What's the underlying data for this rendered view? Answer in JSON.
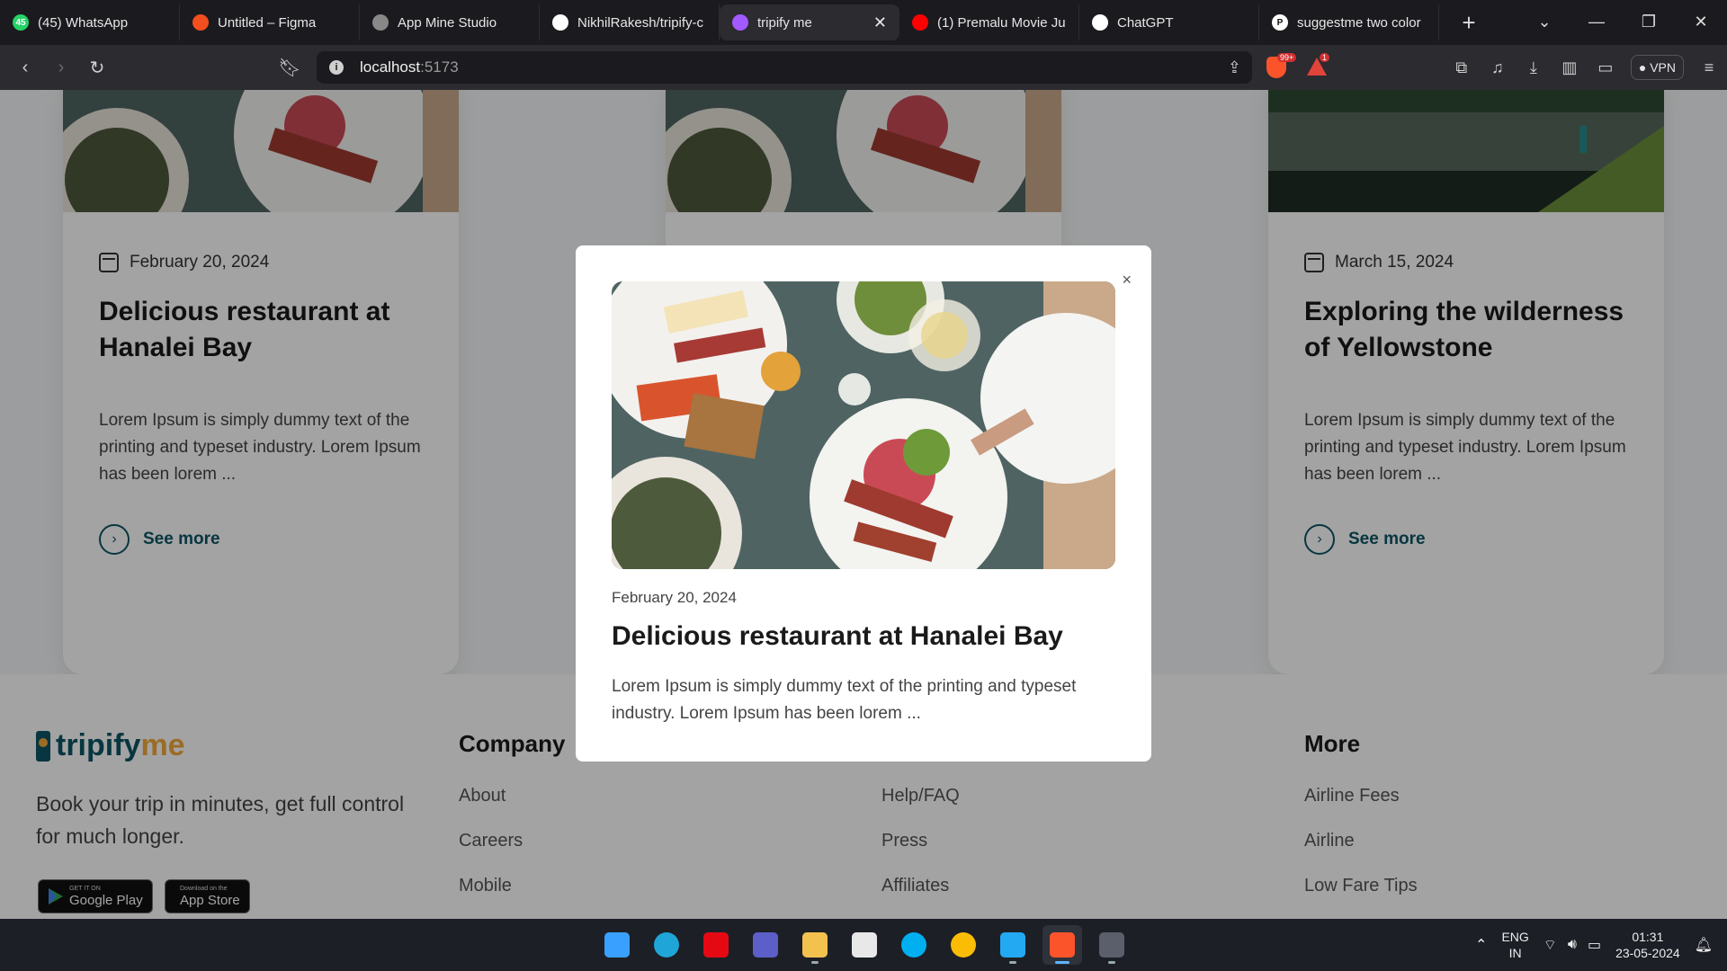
{
  "tabs": [
    {
      "title": "(45) WhatsApp",
      "icon": "whatsapp-icon",
      "color": "#25d366",
      "glyph": "45"
    },
    {
      "title": "Untitled – Figma",
      "icon": "figma-icon",
      "color": "#f24e1e",
      "glyph": ""
    },
    {
      "title": "App Mine Studio",
      "icon": "globe-icon",
      "color": "#888888",
      "glyph": ""
    },
    {
      "title": "NikhilRakesh/tripify-c",
      "icon": "github-icon",
      "color": "#ffffff",
      "glyph": ""
    },
    {
      "title": "tripify me",
      "icon": "vite-icon",
      "color": "#a259ff",
      "glyph": "",
      "active": true
    },
    {
      "title": "(1) Premalu Movie Ju",
      "icon": "youtube-icon",
      "color": "#ff0000",
      "glyph": ""
    },
    {
      "title": "ChatGPT",
      "icon": "chatgpt-icon",
      "color": "#ffffff",
      "glyph": ""
    },
    {
      "title": "suggestme two color",
      "icon": "perplexity-icon",
      "color": "#ffffff",
      "glyph": "P"
    }
  ],
  "address": {
    "host": "localhost",
    "port": ":5173"
  },
  "brave_badge": "99+",
  "alert_badge": "1",
  "vpn_label": "VPN",
  "cards": [
    {
      "date": "February 20, 2024",
      "title": "Delicious restaurant at Hanalei Bay",
      "excerpt": "Lorem Ipsum is simply dummy text of the printing and typeset industry. Lorem Ipsum has been lorem ...",
      "see_more": "See more",
      "image": "food"
    },
    {
      "date": "",
      "title": "",
      "excerpt": "",
      "see_more": "",
      "image": "food"
    },
    {
      "date": "March 15, 2024",
      "title": "Exploring the wilderness of Yellowstone",
      "excerpt": "Lorem Ipsum is simply dummy text of the printing and typeset industry. Lorem Ipsum has been lorem ...",
      "see_more": "See more",
      "image": "lake"
    }
  ],
  "footer": {
    "logo_part1": "tripify",
    "logo_part2": "me",
    "tagline": "Book your trip in minutes, get full control for much longer.",
    "google_play_small": "GET IT ON",
    "google_play": "Google Play",
    "app_store_small": "Download on the",
    "app_store": "App Store",
    "columns": [
      {
        "heading": "Company",
        "links": [
          "About",
          "Careers",
          "Mobile"
        ]
      },
      {
        "heading": "",
        "links": [
          "Help/FAQ",
          "Press",
          "Affiliates"
        ]
      },
      {
        "heading": "More",
        "links": [
          "Airline Fees",
          "Airline",
          "Low Fare Tips"
        ]
      }
    ]
  },
  "modal": {
    "close": "×",
    "date": "February 20, 2024",
    "title": "Delicious restaurant at Hanalei Bay",
    "text": "Lorem Ipsum is simply dummy text of the printing and typeset industry. Lorem Ipsum has been lorem ..."
  },
  "taskbar": {
    "apps": [
      "windows-start-icon",
      "edge-icon",
      "netflix-icon",
      "teams-icon",
      "file-explorer-icon",
      "ms-store-icon",
      "skype-icon",
      "chrome-icon",
      "vscode-icon",
      "brave-icon",
      "terminal-icon"
    ],
    "lang": "ENG",
    "region": "IN",
    "time": "01:31",
    "date": "23-05-2024"
  },
  "colors": {
    "accent": "#0e5565",
    "brand_orange": "#f2a93b"
  }
}
